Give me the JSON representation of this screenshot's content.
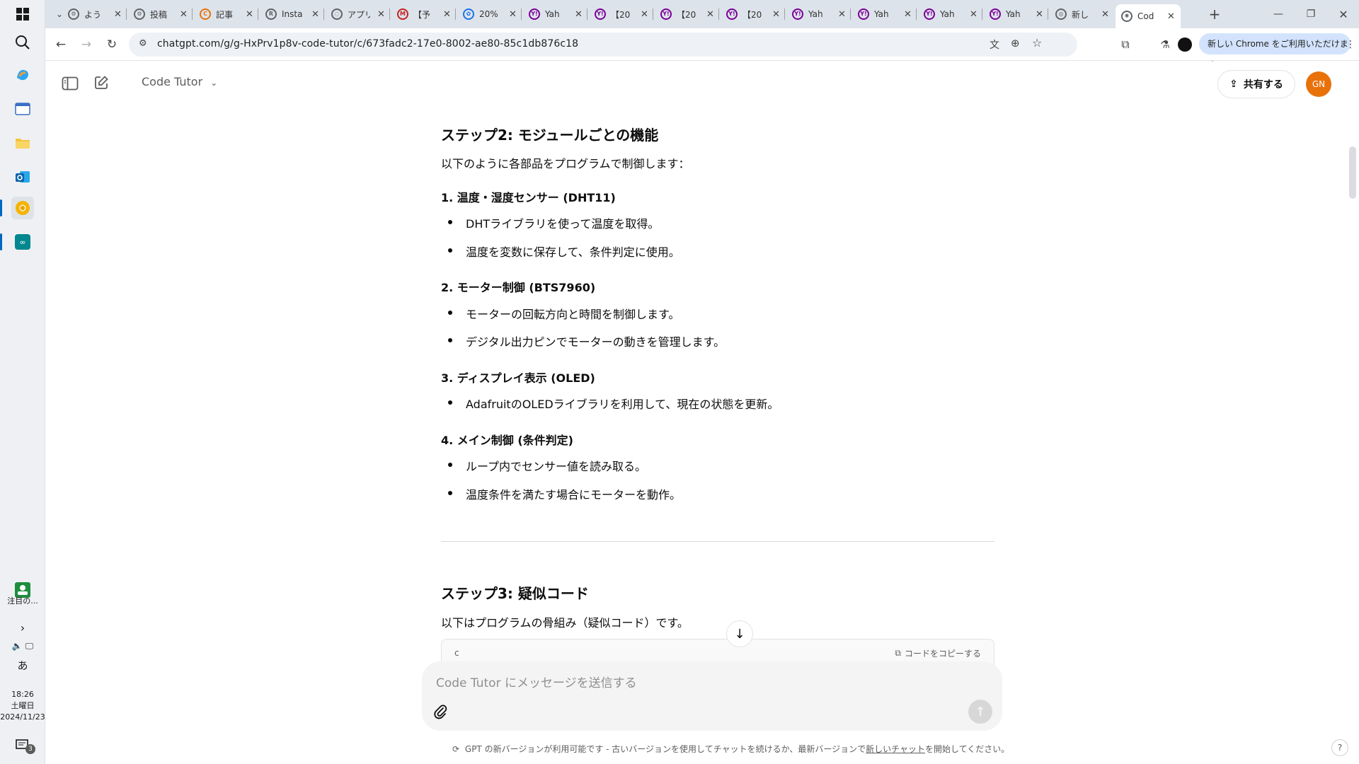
{
  "taskbar": {
    "notify_label": "注目の...",
    "ime": "あ",
    "time": "18:26",
    "weekday": "土曜日",
    "date": "2024/11/23",
    "notification_count": "3"
  },
  "tabs": [
    {
      "label": "よう",
      "icon": "gear"
    },
    {
      "label": "投稿",
      "icon": "gear"
    },
    {
      "label": "記事",
      "icon": "o"
    },
    {
      "label": "Insta",
      "icon": "r"
    },
    {
      "label": "アプリ",
      "icon": "spin"
    },
    {
      "label": "【予",
      "icon": "m"
    },
    {
      "label": "20%",
      "icon": "b"
    },
    {
      "label": "Yah",
      "icon": "y"
    },
    {
      "label": "【20",
      "icon": "y"
    },
    {
      "label": "【20",
      "icon": "y"
    },
    {
      "label": "【20",
      "icon": "y"
    },
    {
      "label": "Yah",
      "icon": "y"
    },
    {
      "label": "Yah",
      "icon": "y"
    },
    {
      "label": "Yah",
      "icon": "y"
    },
    {
      "label": "Yah",
      "icon": "y"
    },
    {
      "label": "新し",
      "icon": "gh"
    },
    {
      "label": "Cod",
      "icon": "gpt"
    }
  ],
  "browser": {
    "url": "chatgpt.com/g/g-HxPrv1p8v-code-tutor/c/673fadc2-17e0-8002-ae80-85c1db876c18",
    "chrome_banner": "新しい Chrome をご利用いただけます"
  },
  "app": {
    "gpt_name": "Code Tutor",
    "share_label": "共有する",
    "avatar_initials": "GN"
  },
  "content": {
    "step2_title": "ステップ2: モジュールごとの機能",
    "step2_intro": "以下のように各部品をプログラムで制御します：",
    "sections": [
      {
        "title": "1. 温度・湿度センサー (DHT11)",
        "bullets": [
          "DHTライブラリを使って温度を取得。",
          "温度を変数に保存して、条件判定に使用。"
        ]
      },
      {
        "title": "2. モーター制御 (BTS7960)",
        "bullets": [
          "モーターの回転方向と時間を制御します。",
          "デジタル出力ピンでモーターの動きを管理します。"
        ]
      },
      {
        "title": "3. ディスプレイ表示 (OLED)",
        "bullets": [
          "AdafruitのOLEDライブラリを利用して、現在の状態を更新。"
        ]
      },
      {
        "title": "4. メイン制御 (条件判定)",
        "bullets": [
          "ループ内でセンサー値を読み取る。",
          "温度条件を満たす場合にモーターを動作。"
        ]
      }
    ],
    "step3_title": "ステップ3: 疑似コード",
    "step3_intro": "以下はプログラムの骨組み（疑似コード）です。",
    "code_lang": "c",
    "copy_label": "コードをコピーする"
  },
  "composer": {
    "placeholder": "Code Tutor にメッセージを送信する"
  },
  "notice": {
    "prefix": "GPT の新バージョンが利用可能です - 古いバージョンを使用してチャットを続けるか、最新バージョンで",
    "link": "新しいチャット",
    "suffix": "を開始してください。"
  },
  "help_label": "?"
}
